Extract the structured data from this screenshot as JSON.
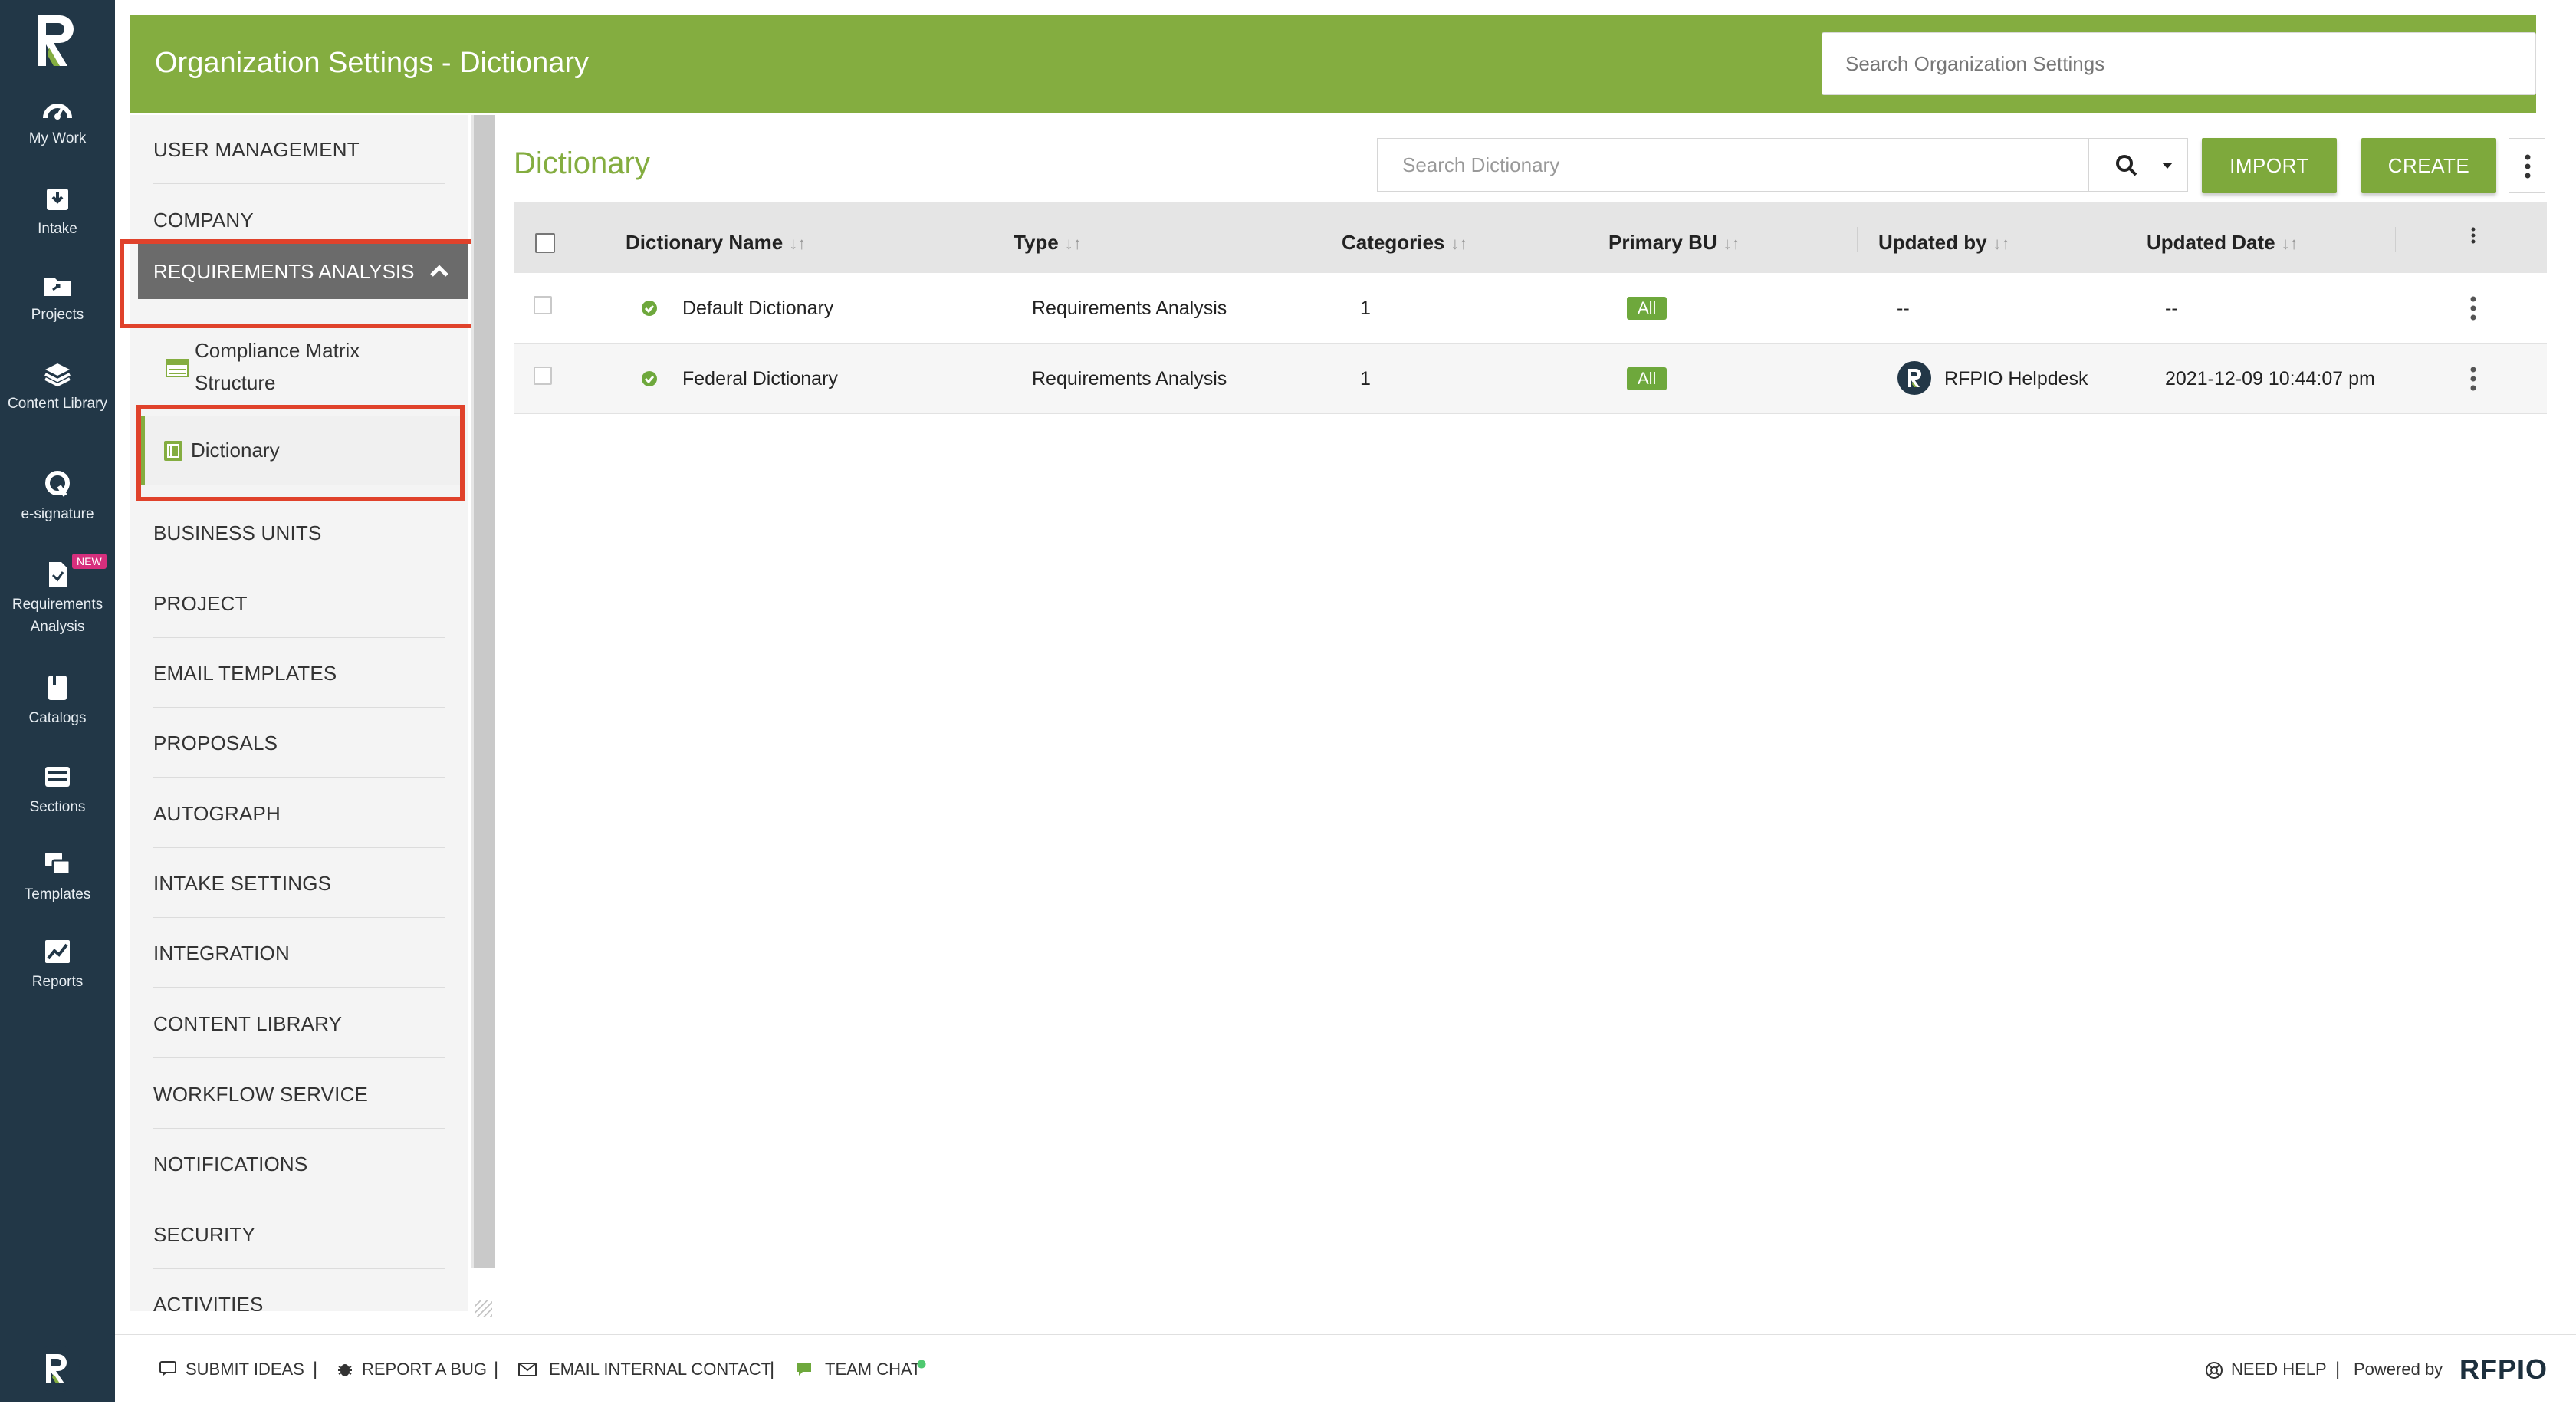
{
  "rail": {
    "items": [
      {
        "label": "My Work",
        "icon": "dashboard-icon"
      },
      {
        "label": "Intake",
        "icon": "intake-tray-icon"
      },
      {
        "label": "Projects",
        "icon": "projects-folder-icon"
      },
      {
        "label": "Content Library",
        "icon": "content-library-stack-icon"
      },
      {
        "label": "e-signature",
        "icon": "e-signature-icon"
      },
      {
        "label": "Requirements Analysis",
        "icon": "requirements-document-icon",
        "badge": "NEW"
      },
      {
        "label": "Catalogs",
        "icon": "catalogs-book-icon"
      },
      {
        "label": "Sections",
        "icon": "sections-icon"
      },
      {
        "label": "Templates",
        "icon": "templates-icon"
      },
      {
        "label": "Reports",
        "icon": "reports-chart-icon"
      }
    ]
  },
  "header": {
    "title": "Organization Settings - Dictionary",
    "search_placeholder": "Search Organization Settings"
  },
  "left_nav": {
    "items_top": [
      "USER MANAGEMENT",
      "COMPANY"
    ],
    "selected": "REQUIREMENTS ANALYSIS",
    "sub_items": [
      "Compliance Matrix Structure",
      "Dictionary"
    ],
    "items_bottom": [
      "BUSINESS UNITS",
      "PROJECT",
      "EMAIL TEMPLATES",
      "PROPOSALS",
      "AUTOGRAPH",
      "INTAKE SETTINGS",
      "INTEGRATION",
      "CONTENT LIBRARY",
      "WORKFLOW SERVICE",
      "NOTIFICATIONS",
      "SECURITY",
      "ACTIVITIES"
    ]
  },
  "main": {
    "title": "Dictionary",
    "search_placeholder": "Search Dictionary",
    "import_label": "IMPORT",
    "create_label": "CREATE"
  },
  "table": {
    "columns": [
      "Dictionary Name",
      "Type",
      "Categories",
      "Primary BU",
      "Updated by",
      "Updated Date"
    ],
    "rows": [
      {
        "name": "Default Dictionary",
        "type": "Requirements Analysis",
        "categories": "1",
        "primary_bu": "All",
        "updated_by": "--",
        "updated_date": "--",
        "status_color": "#6ea83c"
      },
      {
        "name": "Federal Dictionary",
        "type": "Requirements Analysis",
        "categories": "1",
        "primary_bu": "All",
        "updated_by": "RFPIO Helpdesk",
        "updated_date": "2021-12-09 10:44:07 pm",
        "status_color": "#6ea83c"
      }
    ]
  },
  "footer": {
    "submit_ideas": "SUBMIT IDEAS",
    "report_bug": "REPORT A BUG",
    "email_contact": "EMAIL INTERNAL CONTACT",
    "team_chat": "TEAM CHAT",
    "need_help": "NEED HELP",
    "powered_by": "Powered by",
    "brand": "RFPIO"
  },
  "colors": {
    "brand_green": "#84ad40",
    "rail_navy": "#223747",
    "highlight_red": "#e0422b",
    "new_badge": "#d72f7d"
  }
}
